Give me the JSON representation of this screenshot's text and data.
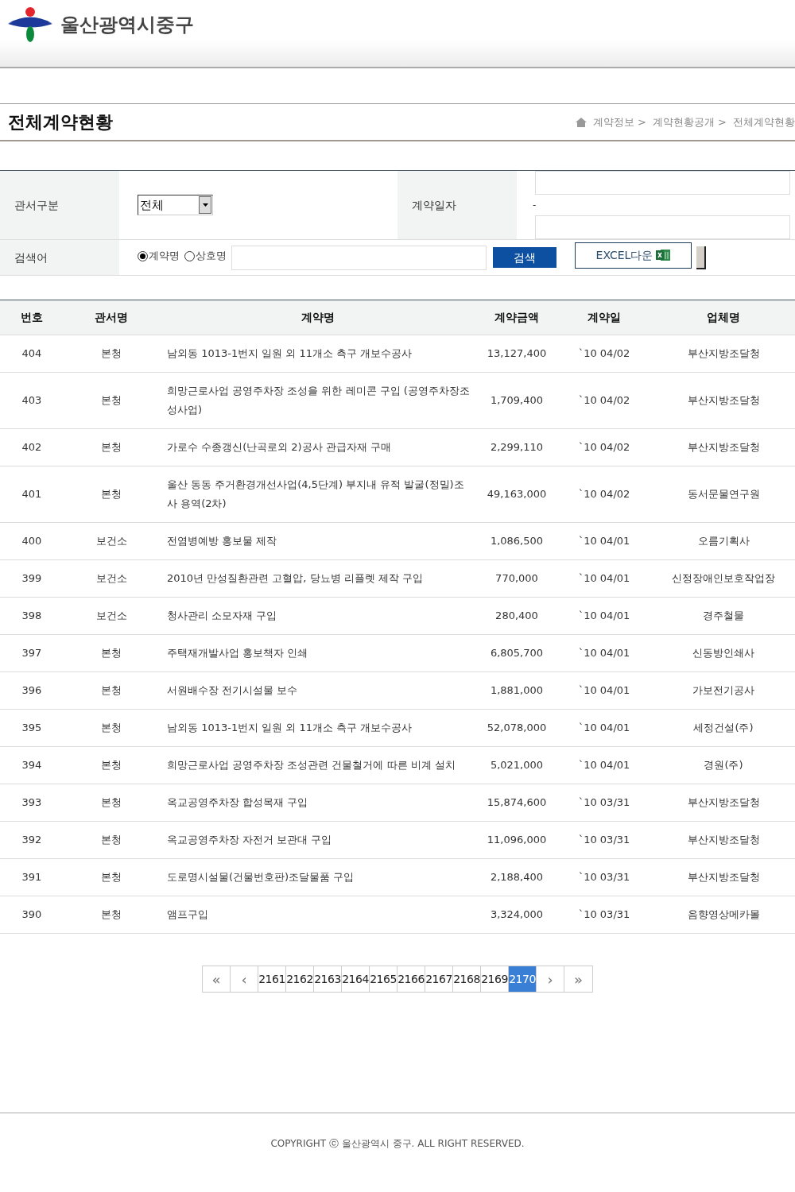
{
  "header": {
    "logo_text": "울산광역시중구"
  },
  "page_title": "전체계약현황",
  "breadcrumb": [
    "계약정보 >",
    "계약현황공개 >",
    "전체계약현황"
  ],
  "search_form": {
    "office_label": "관서구분",
    "office_select": "전체",
    "date_label": "계약일자",
    "date_separator": "-",
    "keyword_label": "검색어",
    "radios": [
      {
        "label": "계약명",
        "selected": true
      },
      {
        "label": "상호명",
        "selected": false
      }
    ],
    "search_button": "검색",
    "excel_button": "EXCEL다운"
  },
  "table": {
    "columns": [
      "번호",
      "관서명",
      "계약명",
      "계약금액",
      "계약일",
      "업체명"
    ],
    "rows": [
      [
        "404",
        "본청",
        "남외동 1013-1번지 일원 외 11개소 측구 개보수공사",
        "13,127,400",
        "`10 04/02",
        "부산지방조달청"
      ],
      [
        "403",
        "본청",
        "희망근로사업 공영주차장 조성을 위한 레미콘 구입 (공영주차장조성사업)",
        "1,709,400",
        "`10 04/02",
        "부산지방조달청"
      ],
      [
        "402",
        "본청",
        "가로수 수종갱신(난곡로외 2)공사 관급자재 구매",
        "2,299,110",
        "`10 04/02",
        "부산지방조달청"
      ],
      [
        "401",
        "본청",
        "울산 동동 주거환경개선사업(4,5단계) 부지내 유적 발굴(정밀)조사 용역(2차)",
        "49,163,000",
        "`10 04/02",
        "동서문물연구원"
      ],
      [
        "400",
        "보건소",
        "전염병예방 홍보물 제작",
        "1,086,500",
        "`10 04/01",
        "오름기획사"
      ],
      [
        "399",
        "보건소",
        "2010년 만성질환관련 고혈압, 당뇨병 리플렛 제작 구입",
        "770,000",
        "`10 04/01",
        "신정장애인보호작업장"
      ],
      [
        "398",
        "보건소",
        "청사관리 소모자재 구입",
        "280,400",
        "`10 04/01",
        "경주철물"
      ],
      [
        "397",
        "본청",
        "주택재개발사업 홍보책자 인쇄",
        "6,805,700",
        "`10 04/01",
        "신동방인쇄사"
      ],
      [
        "396",
        "본청",
        "서원배수장 전기시설물 보수",
        "1,881,000",
        "`10 04/01",
        "가보전기공사"
      ],
      [
        "395",
        "본청",
        "남외동 1013-1번지 일원 외 11개소 측구 개보수공사",
        "52,078,000",
        "`10 04/01",
        "세정건설(주)"
      ],
      [
        "394",
        "본청",
        "희망근로사업 공영주차장 조성관련 건물철거에 따른 비계 설치",
        "5,021,000",
        "`10 04/01",
        "경원(주)"
      ],
      [
        "393",
        "본청",
        "옥교공영주차장 합성목재 구입",
        "15,874,600",
        "`10 03/31",
        "부산지방조달청"
      ],
      [
        "392",
        "본청",
        "옥교공영주차장 자전거 보관대 구입",
        "11,096,000",
        "`10 03/31",
        "부산지방조달청"
      ],
      [
        "391",
        "본청",
        "도로명시설물(건물번호판)조달물품 구입",
        "2,188,400",
        "`10 03/31",
        "부산지방조달청"
      ],
      [
        "390",
        "본청",
        "앰프구입",
        "3,324,000",
        "`10 03/31",
        "음향영상메카몰"
      ]
    ]
  },
  "pagination": {
    "first": "«",
    "prev": "‹",
    "next": "›",
    "last": "»",
    "pages": [
      {
        "label": "2161",
        "selected": false
      },
      {
        "label": "2162",
        "selected": false
      },
      {
        "label": "2163",
        "selected": false
      },
      {
        "label": "2164",
        "selected": false
      },
      {
        "label": "2165",
        "selected": false
      },
      {
        "label": "2166",
        "selected": false
      },
      {
        "label": "2167",
        "selected": false
      },
      {
        "label": "2168",
        "selected": false
      },
      {
        "label": "2169",
        "selected": false
      },
      {
        "label": "2170",
        "selected": true
      }
    ]
  },
  "footer": "COPYRIGHT ⓒ 울산광역시 중구. ALL RIGHT RESERVED."
}
